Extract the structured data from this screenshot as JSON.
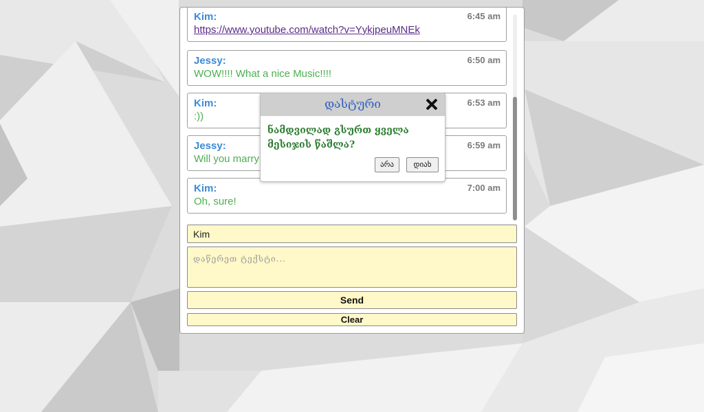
{
  "chat": {
    "messages": [
      {
        "author": "Kim",
        "time": "6:45 am",
        "text": "https://www.youtube.com/watch?v=YykjpeuMNEk",
        "is_link": true
      },
      {
        "author": "Jessy:",
        "time": "6:50 am",
        "text": "WOW!!!! What a nice Music!!!!"
      },
      {
        "author": "Kim:",
        "time": "6:53 am",
        "text": ":))"
      },
      {
        "author": "Jessy:",
        "time": "6:59 am",
        "text": "Will you marry"
      },
      {
        "author": "Kim:",
        "time": "7:00 am",
        "text": "Oh, sure!"
      }
    ],
    "first_author": "Kim:"
  },
  "form": {
    "name_value": "Kim",
    "message_placeholder": "დაწერეთ ტექსტი...",
    "send_label": "Send",
    "clear_label": "Clear"
  },
  "modal": {
    "title": "დასტური",
    "message": "ნამდვილად გსურთ ყველა მესიჯის წაშლა?",
    "no_label": "არა",
    "yes_label": "დიახ"
  },
  "colors": {
    "author": "#3a8ad6",
    "message_text": "#4caf50",
    "field_bg": "#fff8c8",
    "modal_title": "#2f5fbf",
    "modal_message": "#2e7d32"
  }
}
